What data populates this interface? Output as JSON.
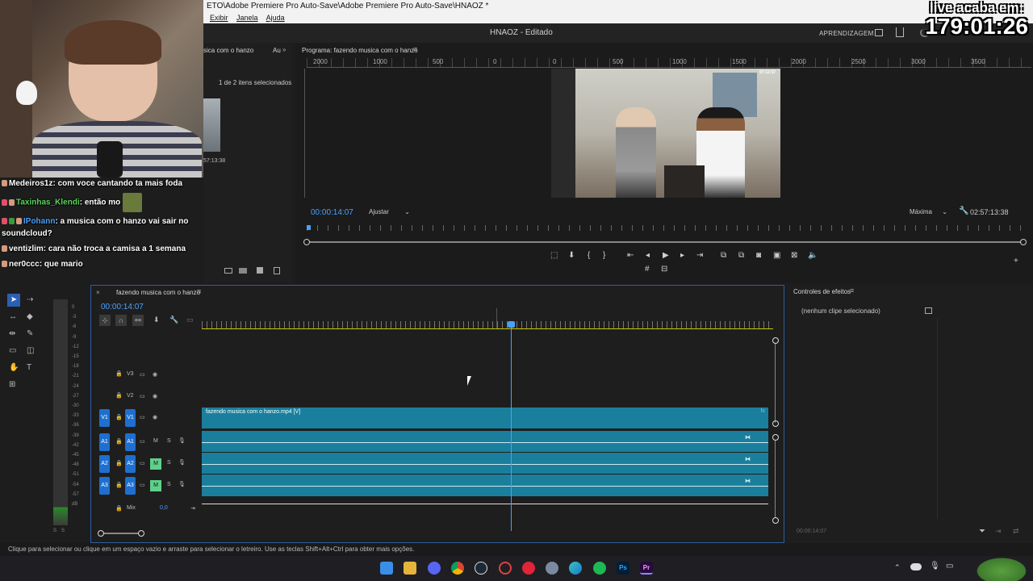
{
  "window": {
    "title": "ETO\\Adobe Premiere Pro Auto-Save\\Adobe Premiere Pro Auto-Save\\HNAOZ *",
    "menu": [
      "Exibir",
      "Janela",
      "Ajuda"
    ]
  },
  "header": {
    "project_name": "HNAOZ - Editado",
    "learn_label": "APRENDIZAGEM"
  },
  "overlay": {
    "timer_label": "live acaba em:",
    "timer_value": "179:01:26"
  },
  "chat": [
    {
      "user": "Medeiros1z",
      "user_color": "#ffffff",
      "text": "com voce cantando ta mais foda"
    },
    {
      "user": "Taxinhas_Klendi",
      "user_color": "#5bd65b",
      "text": "então mo"
    },
    {
      "user": "IPohann",
      "user_color": "#4aa0ff",
      "text": "a musica com o hanzo vai sair no soundcloud?"
    },
    {
      "user": "ventizlim",
      "user_color": "#ffffff",
      "text": "cara não troca a camisa a 1 semana"
    },
    {
      "user": "ner0ccc",
      "user_color": "#ffffff",
      "text": "que mario"
    }
  ],
  "project_panel": {
    "tab": "sica com o hanzo",
    "tab2": "Au",
    "selection": "1 de 2 itens selecionados",
    "duration": "57:13:38"
  },
  "program": {
    "title": "Programa: fazendo musica com o hanzo",
    "ruler_labels": [
      "2000",
      "1000",
      "500",
      "0",
      "500",
      "1000",
      "1500",
      "2000",
      "2500",
      "3000",
      "3500"
    ],
    "timecode": "00:00:14:07",
    "fit_label": "Ajustar",
    "quality_label": "Máxima",
    "duration": "02:57:13:38",
    "preview_time": "97:12:57"
  },
  "timeline": {
    "title": "fazendo musica com o hanzo",
    "timecode": "00:00:14:07",
    "clip_label": "fazendo musica com o hanzo.mp4 [V]",
    "mix_label": "Mix",
    "mix_value": "0,0",
    "tracks": [
      {
        "name": "V3",
        "type": "video"
      },
      {
        "name": "V2",
        "type": "video"
      },
      {
        "name": "V1",
        "type": "video"
      },
      {
        "name": "A1",
        "type": "audio"
      },
      {
        "name": "A2",
        "type": "audio"
      },
      {
        "name": "A3",
        "type": "audio"
      }
    ],
    "playhead_fraction": 0.547
  },
  "meters": {
    "scale": [
      "0",
      "-3",
      "-6",
      "-9",
      "-12",
      "-15",
      "-18",
      "-21",
      "-24",
      "-27",
      "-30",
      "-33",
      "-36",
      "-39",
      "-42",
      "-45",
      "-48",
      "-51",
      "-54",
      "-57",
      "dB"
    ],
    "solo_labels": [
      "S",
      "S"
    ]
  },
  "effects": {
    "title": "Controles de efeitos",
    "empty": "(nenhum clipe selecionado)",
    "timecode": "00:00:14:07"
  },
  "status": {
    "hint": "Clique para selecionar ou clique em um espaço vazio e arraste para selecionar o letreiro. Use as teclas Shift+Alt+Ctrl para obter mais opções."
  },
  "colors": {
    "accent_blue": "#4aa0ff",
    "clip_teal": "#1a7f9c",
    "timeline_border": "#2d5ea0",
    "toggle_blue": "#1e6fd0",
    "mute_green": "#5fd08a"
  },
  "taskbar_icons": [
    "start-icon",
    "folder-icon",
    "discord-icon",
    "chrome-icon",
    "steam-icon",
    "app-icon",
    "opera-icon",
    "settings-icon",
    "edge-icon",
    "spotify-icon",
    "photoshop-icon",
    "premiere-icon"
  ]
}
